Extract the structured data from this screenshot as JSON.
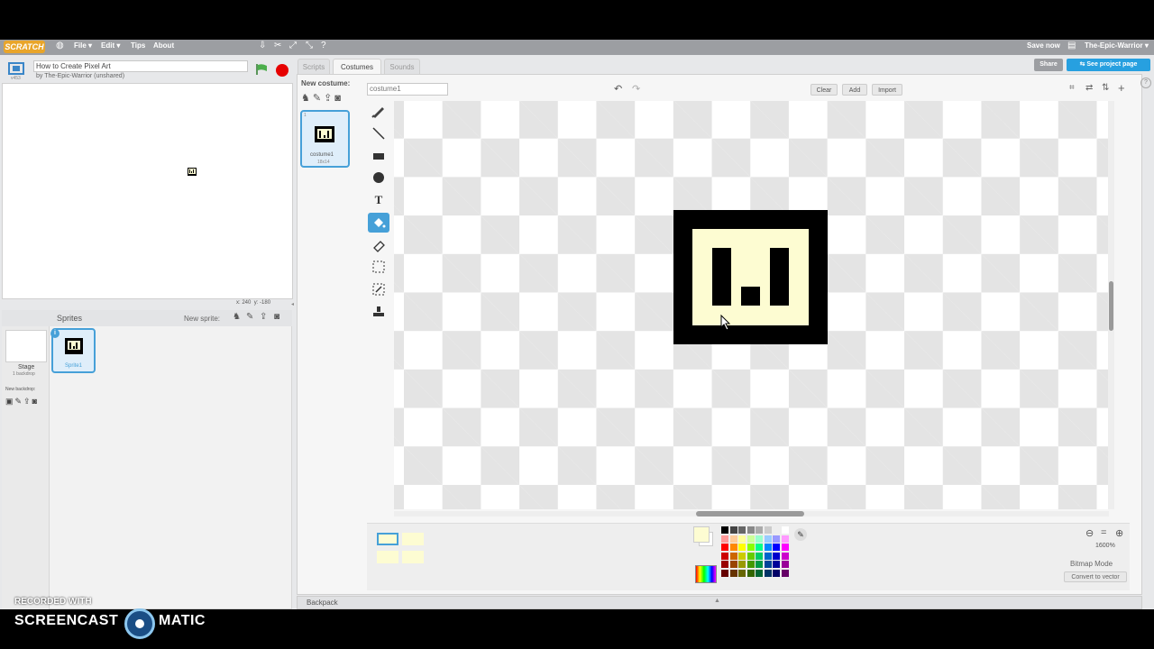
{
  "menubar": {
    "logo": "SCRATCH",
    "file": "File ▾",
    "edit": "Edit ▾",
    "tips": "Tips",
    "about": "About",
    "save_now": "Save now",
    "user": "The-Epic-Warrior ▾"
  },
  "project": {
    "title": "How to Create Pixel Art",
    "byline": "by The-Epic-Warrior (unshared)",
    "version": "v453"
  },
  "stage": {
    "x_label": "x:",
    "x_value": "240",
    "y_label": "y:",
    "y_value": "-180"
  },
  "sprites": {
    "header": "Sprites",
    "new_sprite": "New sprite:",
    "stage_label": "Stage",
    "stage_sub": "1 backdrop",
    "new_backdrop": "New backdrop:",
    "sprite1": "Sprite1"
  },
  "tabs": [
    "Scripts",
    "Costumes",
    "Sounds"
  ],
  "top_right": {
    "share": "Share",
    "see_project": "See project page"
  },
  "costumes": {
    "new_costume": "New costume:",
    "item_number": "1",
    "item_name": "costume1",
    "item_size": "18x14",
    "name_value": "costume1"
  },
  "editor": {
    "clear": "Clear",
    "add": "Add",
    "import": "Import",
    "zoom": "1600%",
    "mode": "Bitmap Mode",
    "convert": "Convert to vector"
  },
  "backpack": "Backpack",
  "watermark": {
    "recorded": "RECORDED WITH",
    "brand1": "SCREENCAST",
    "brand2": "MATIC"
  },
  "colors": {
    "fill_color": "#fdfcd2",
    "art_black": "#000000",
    "accent": "#46a0d8"
  }
}
